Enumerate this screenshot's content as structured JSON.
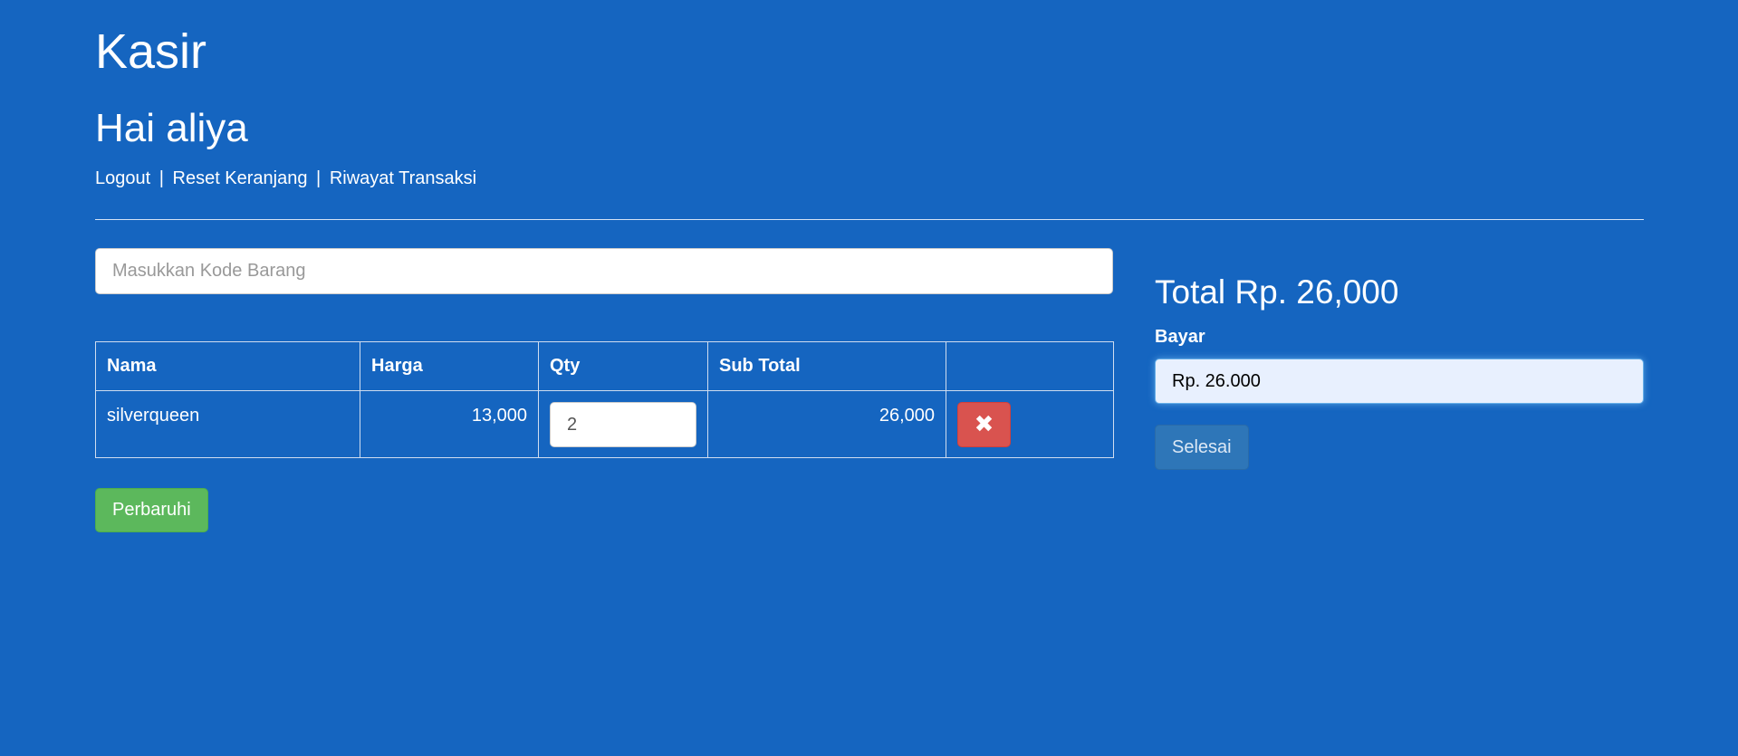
{
  "app": {
    "title": "Kasir",
    "greeting": "Hai aliya"
  },
  "nav": {
    "logout": "Logout",
    "separator": "|",
    "reset_cart": "Reset Keranjang",
    "history": "Riwayat Transaksi"
  },
  "search": {
    "placeholder": "Masukkan Kode Barang",
    "value": ""
  },
  "cart": {
    "headers": {
      "nama": "Nama",
      "harga": "Harga",
      "qty": "Qty",
      "subtotal": "Sub Total",
      "action": ""
    },
    "rows": [
      {
        "nama": "silverqueen",
        "harga": "13,000",
        "qty": "2",
        "subtotal": "26,000",
        "delete_icon": "times-icon",
        "delete_glyph": "✖"
      }
    ],
    "update_label": "Perbaruhi"
  },
  "payment": {
    "total": "Total Rp. 26,000",
    "bayar_label": "Bayar",
    "bayar_value": "Rp. 26.000",
    "finish_label": "Selesai"
  },
  "colors": {
    "background": "#1565c0",
    "success": "#5cb85c",
    "danger": "#d9534f",
    "primary": "#337ab7"
  }
}
